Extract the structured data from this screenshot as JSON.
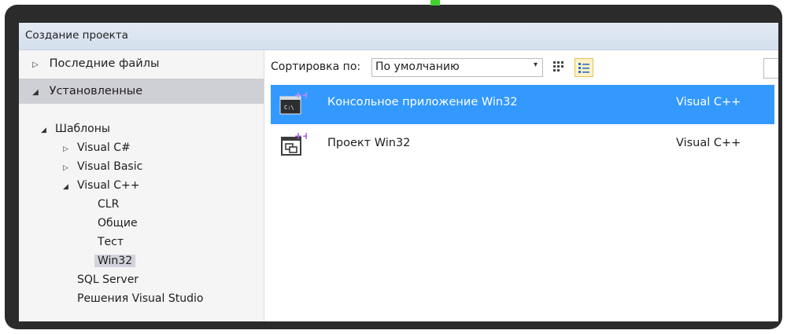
{
  "window": {
    "title": "Создание проекта"
  },
  "sidebar": {
    "recent": {
      "label": "Последние файлы",
      "arrow": "▷"
    },
    "installed": {
      "label": "Установленные",
      "arrow": "◢"
    },
    "tree": {
      "templates": {
        "label": "Шаблоны",
        "arrow": "◢"
      },
      "csharp": {
        "label": "Visual C#",
        "arrow": "▷"
      },
      "vb": {
        "label": "Visual Basic",
        "arrow": "▷"
      },
      "vcpp": {
        "label": "Visual C++",
        "arrow": "◢"
      },
      "clr": "CLR",
      "general": "Общие",
      "test": "Тест",
      "win32": "Win32",
      "sql": "SQL Server",
      "solutions": "Решения Visual Studio"
    }
  },
  "toolbar": {
    "sort_label": "Сортировка по:",
    "sort_value": "По умолчанию",
    "caret": "▾"
  },
  "templates": [
    {
      "name": "Консольное приложение Win32",
      "language": "Visual C++",
      "icon": "console-app-icon",
      "selected": true
    },
    {
      "name": "Проект Win32",
      "language": "Visual C++",
      "icon": "win32-project-icon",
      "selected": false
    }
  ],
  "colors": {
    "selection": "#3399ff",
    "accent_plus": "#a35bd6",
    "frame": "#2b2b2b"
  }
}
